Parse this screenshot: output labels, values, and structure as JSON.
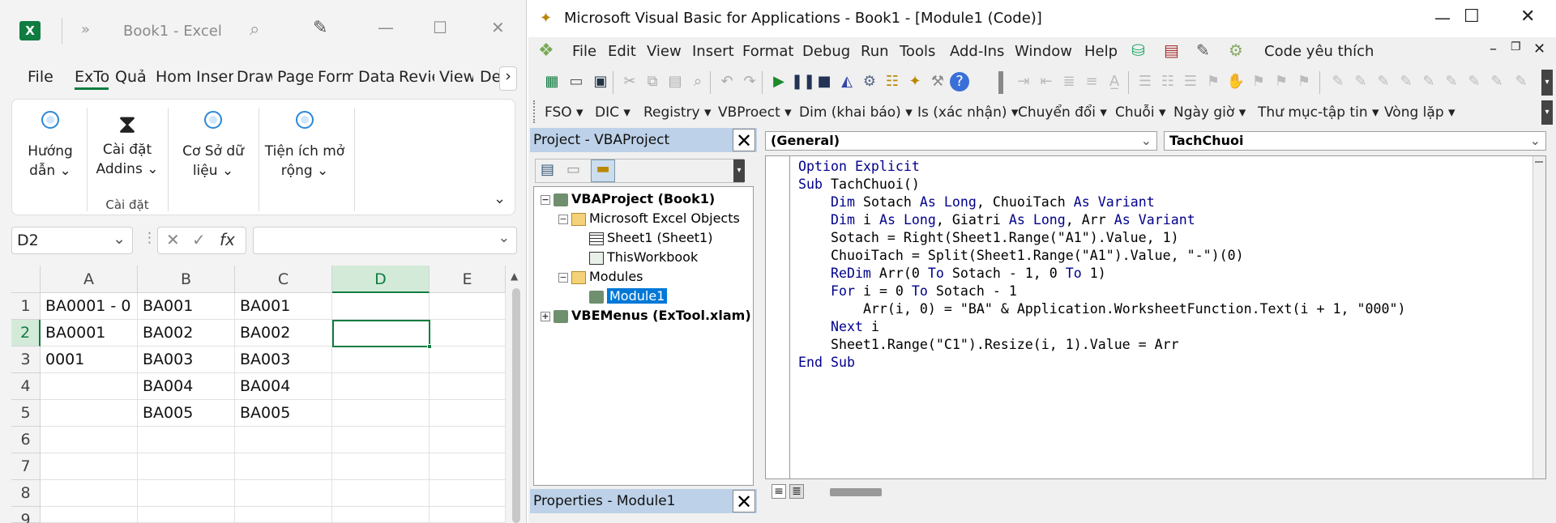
{
  "excel": {
    "title": "Book1  -  Excel",
    "logo_text": "X",
    "tabs": [
      "File",
      "ExTo",
      "Quả",
      "Hom",
      "Inser",
      "Draw",
      "Page",
      "Form",
      "Data",
      "Revie",
      "View",
      "De"
    ],
    "ribbon": {
      "buttons": [
        {
          "label1": "Hướng",
          "label2": "dẫn ⌄"
        },
        {
          "label1": "Cài đặt",
          "label2": "Addins ⌄"
        },
        {
          "label1": "Cơ Sở dữ",
          "label2": "liệu ⌄"
        },
        {
          "label1": "Tiện ích mở",
          "label2": "rộng ⌄"
        }
      ],
      "group_label": "Cài đặt"
    },
    "name_box": "D2",
    "fx_label": "fx",
    "columns": [
      "A",
      "B",
      "C",
      "D",
      "E"
    ],
    "rows": [
      "1",
      "2",
      "3",
      "4",
      "5",
      "6",
      "7",
      "8",
      "9"
    ],
    "cells": [
      [
        "BA0001 - 0",
        "BA001",
        "BA001",
        "",
        ""
      ],
      [
        "BA0001",
        "BA002",
        "BA002",
        "",
        ""
      ],
      [
        "0001",
        "BA003",
        "BA003",
        "",
        ""
      ],
      [
        "",
        "BA004",
        "BA004",
        "",
        ""
      ],
      [
        "",
        "BA005",
        "BA005",
        "",
        ""
      ],
      [
        "",
        "",
        "",
        "",
        ""
      ],
      [
        "",
        "",
        "",
        "",
        ""
      ],
      [
        "",
        "",
        "",
        "",
        ""
      ],
      [
        "",
        "",
        "",
        "",
        ""
      ]
    ],
    "accent": "#107c41"
  },
  "vba": {
    "title": "Microsoft Visual Basic for Applications - Book1 - [Module1 (Code)]",
    "menu": [
      "File",
      "Edit",
      "View",
      "Insert",
      "Format",
      "Debug",
      "Run",
      "Tools",
      "Add-Ins",
      "Window",
      "Help"
    ],
    "menu_extra": "Code yêu thích",
    "toolbar2": [
      "FSO ▾",
      "DIC ▾",
      "Registry ▾",
      "VBProect ▾",
      "Dim (khai báo) ▾",
      "Is (xác nhận) ▾",
      "Chuyển đổi ▾",
      "Chuỗi ▾",
      "Ngày giờ ▾",
      "Thư mục-tập tin ▾",
      "Vòng lặp ▾"
    ],
    "project_header": "Project - VBAProject",
    "properties_header": "Properties - Module1",
    "tree": {
      "root": "VBAProject (Book1)",
      "excel_objects": "Microsoft Excel Objects",
      "sheet1": "Sheet1 (Sheet1)",
      "thisworkbook": "ThisWorkbook",
      "modules": "Modules",
      "module1": "Module1",
      "vbemenus": "VBEMenus (ExTool.xlam)"
    },
    "object_dropdown": "(General)",
    "proc_dropdown": "TachChuoi",
    "code_lines": [
      "Option Explicit",
      "Sub TachChuoi()",
      "    Dim Sotach As Long, ChuoiTach As Variant",
      "    Dim i As Long, Giatri As Long, Arr As Variant",
      "    Sotach = Right(Sheet1.Range(\"A1\").Value, 1)",
      "    ChuoiTach = Split(Sheet1.Range(\"A1\").Value, \"-\")(0)",
      "    ReDim Arr(0 To Sotach - 1, 0 To 1)",
      "    For i = 0 To Sotach - 1",
      "        Arr(i, 0) = \"BA\" & Application.WorksheetFunction.Text(i + 1, \"000\")",
      "    Next i",
      "    Sheet1.Range(\"C1\").Resize(i, 1).Value = Arr",
      "End Sub"
    ],
    "keyword_color": "#00008b",
    "selection_color": "#0078d7"
  }
}
